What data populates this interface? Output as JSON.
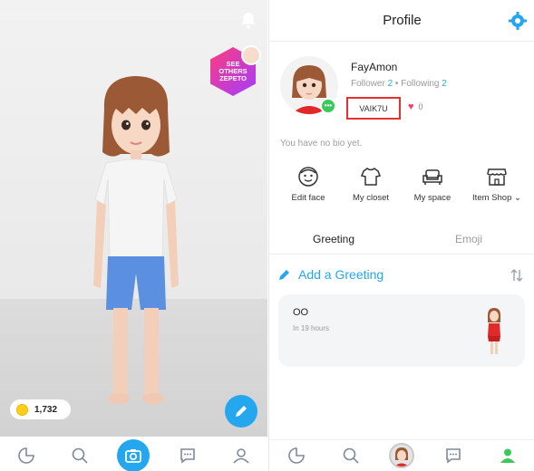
{
  "left_panel": {
    "see_others_badge": "SEE OTHERS ZEPETO",
    "coin_count": "1,732",
    "nav": [
      "home-icon",
      "search-icon",
      "camera-icon",
      "chat-icon",
      "profile-icon"
    ]
  },
  "profile": {
    "header_title": "Profile",
    "username": "FayAmon",
    "follower_label": "Follower",
    "follower_count": "2",
    "separator": "•",
    "following_label": "Following",
    "following_count": "2",
    "code": "VAIK7U",
    "likes": "0",
    "bio": "You have no bio yet.",
    "actions": {
      "edit_face": "Edit face",
      "my_closet": "My closet",
      "my_space": "My space",
      "item_shop": "Item Shop ⌄"
    },
    "tabs": {
      "greeting": "Greeting",
      "emoji": "Emoji"
    },
    "add_greeting": "Add a Greeting",
    "greeting_card": {
      "title": "OO",
      "time": "In 19 hours"
    }
  },
  "colors": {
    "accent": "#24a7ee",
    "highlight_box": "#e53030",
    "online": "#3cc95b",
    "heart": "#ff3a6b"
  }
}
